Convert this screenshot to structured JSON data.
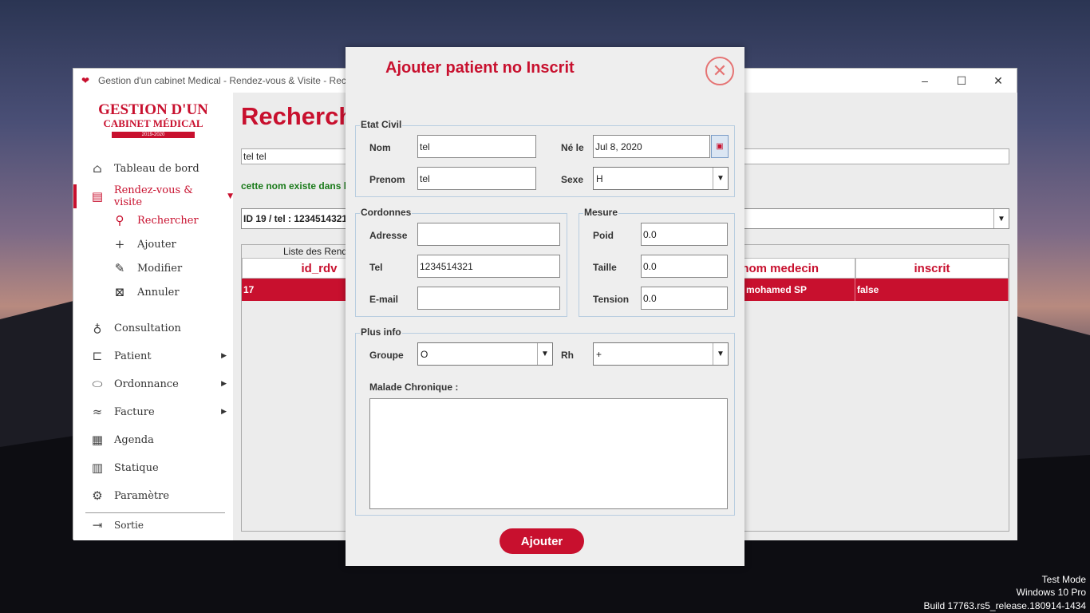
{
  "window": {
    "title": "Gestion d'un cabinet Medical - Rendez-vous & Visite - Rech",
    "controls": {
      "minimize": "–",
      "maximize": "☐",
      "close": "✕"
    }
  },
  "logo": {
    "line1": "GESTION D'UN",
    "line2": "CABINET MÉDICAL",
    "line3": "2019-2020"
  },
  "sidebar": {
    "items": [
      {
        "label": "Tableau de bord",
        "icon": "home-icon"
      },
      {
        "label": "Rendez-vous & visite",
        "icon": "calendar-list-icon"
      },
      {
        "label": "Consultation",
        "icon": "stethoscope-icon"
      },
      {
        "label": "Patient",
        "icon": "bed-icon"
      },
      {
        "label": "Ordonnance",
        "icon": "pill-icon"
      },
      {
        "label": "Facture",
        "icon": "money-hand-icon"
      },
      {
        "label": "Agenda",
        "icon": "calendar-icon"
      },
      {
        "label": "Statique",
        "icon": "bar-chart-icon"
      },
      {
        "label": "Paramètre",
        "icon": "gear-icon"
      },
      {
        "label": "Sortie",
        "icon": "logout-icon"
      }
    ],
    "subitems": [
      {
        "label": "Rechercher",
        "icon": "search-icon"
      },
      {
        "label": "Ajouter",
        "icon": "plus-icon"
      },
      {
        "label": "Modifier",
        "icon": "pencil-icon"
      },
      {
        "label": "Annuler",
        "icon": "trash-icon"
      }
    ]
  },
  "content": {
    "title": "Recherch",
    "search_value": "tel tel",
    "message": "cette nom existe dans l",
    "rdv_selected": "ID 19 / tel : 1234514321",
    "table_caption": "Liste des Rend",
    "columns": [
      "id_rdv",
      "nom medecin",
      "inscrit"
    ],
    "rows": [
      {
        "id_rdv": "17",
        "nom_medecin": "mohamed SP",
        "inscrit": "false"
      }
    ]
  },
  "dialog": {
    "title": "Ajouter patient no Inscrit",
    "etat_civil": {
      "legend": "Etat Civil",
      "nom_label": "Nom",
      "nom_value": "tel",
      "prenom_label": "Prenom",
      "prenom_value": "tel",
      "ne_le_label": "Né le",
      "ne_le_value": "Jul 8, 2020",
      "sexe_label": "Sexe",
      "sexe_value": "H"
    },
    "cordonnes": {
      "legend": "Cordonnes",
      "adresse_label": "Adresse",
      "adresse_value": "",
      "tel_label": "Tel",
      "tel_value": "1234514321",
      "email_label": "E-mail",
      "email_value": ""
    },
    "mesure": {
      "legend": "Mesure",
      "poid_label": "Poid",
      "poid_value": "0.0",
      "taille_label": "Taille",
      "taille_value": "0.0",
      "tension_label": "Tension",
      "tension_value": "0.0"
    },
    "plus_info": {
      "legend": "Plus info",
      "groupe_label": "Groupe",
      "groupe_value": "O",
      "rh_label": "Rh",
      "rh_value": "+",
      "malade_label": "Malade Chronique :",
      "malade_value": ""
    },
    "submit_label": "Ajouter"
  },
  "desktop_watermark": {
    "line1": "Test Mode",
    "line2": "Windows 10 Pro",
    "line3": "Build 17763.rs5_release.180914-1434"
  },
  "colors": {
    "accent": "#c8102e",
    "info_text": "#1a7a1a",
    "group_border": "#b8cde0"
  }
}
